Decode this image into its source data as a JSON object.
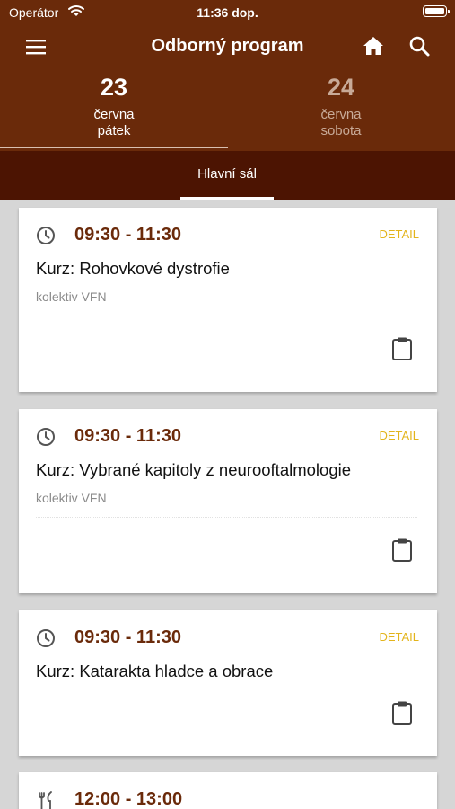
{
  "status_bar": {
    "carrier": "Operátor",
    "time": "11:36 dop."
  },
  "toolbar": {
    "title": "Odborný program"
  },
  "day_tabs": [
    {
      "day": "23",
      "month": "června",
      "weekday": "pátek",
      "selected": true
    },
    {
      "day": "24",
      "month": "června",
      "weekday": "sobota",
      "selected": false
    }
  ],
  "hall_tabs": [
    {
      "label": "Hlavní sál",
      "selected": true
    }
  ],
  "sessions": [
    {
      "time": "09:30 - 11:30",
      "title": "Kurz: Rohovkové dystrofie",
      "speaker": "kolektiv VFN",
      "detail_label": "DETAIL",
      "icon": "clock-icon"
    },
    {
      "time": "09:30 - 11:30",
      "title": "Kurz: Vybrané kapitoly z neurooftalmologie",
      "speaker": "kolektiv VFN",
      "detail_label": "DETAIL",
      "icon": "clock-icon"
    },
    {
      "time": "09:30 - 11:30",
      "title": "Kurz: Katarakta hladce a obrace",
      "speaker": "",
      "detail_label": "DETAIL",
      "icon": "clock-icon"
    },
    {
      "time": "12:00 - 13:00",
      "title": "",
      "speaker": "",
      "detail_label": "",
      "icon": "cutlery-icon"
    }
  ],
  "colors": {
    "header": "#6a2a0a",
    "hall_bar": "#4c1402",
    "accent_detail": "#e3b41b",
    "time_text": "#6a2a0a"
  }
}
